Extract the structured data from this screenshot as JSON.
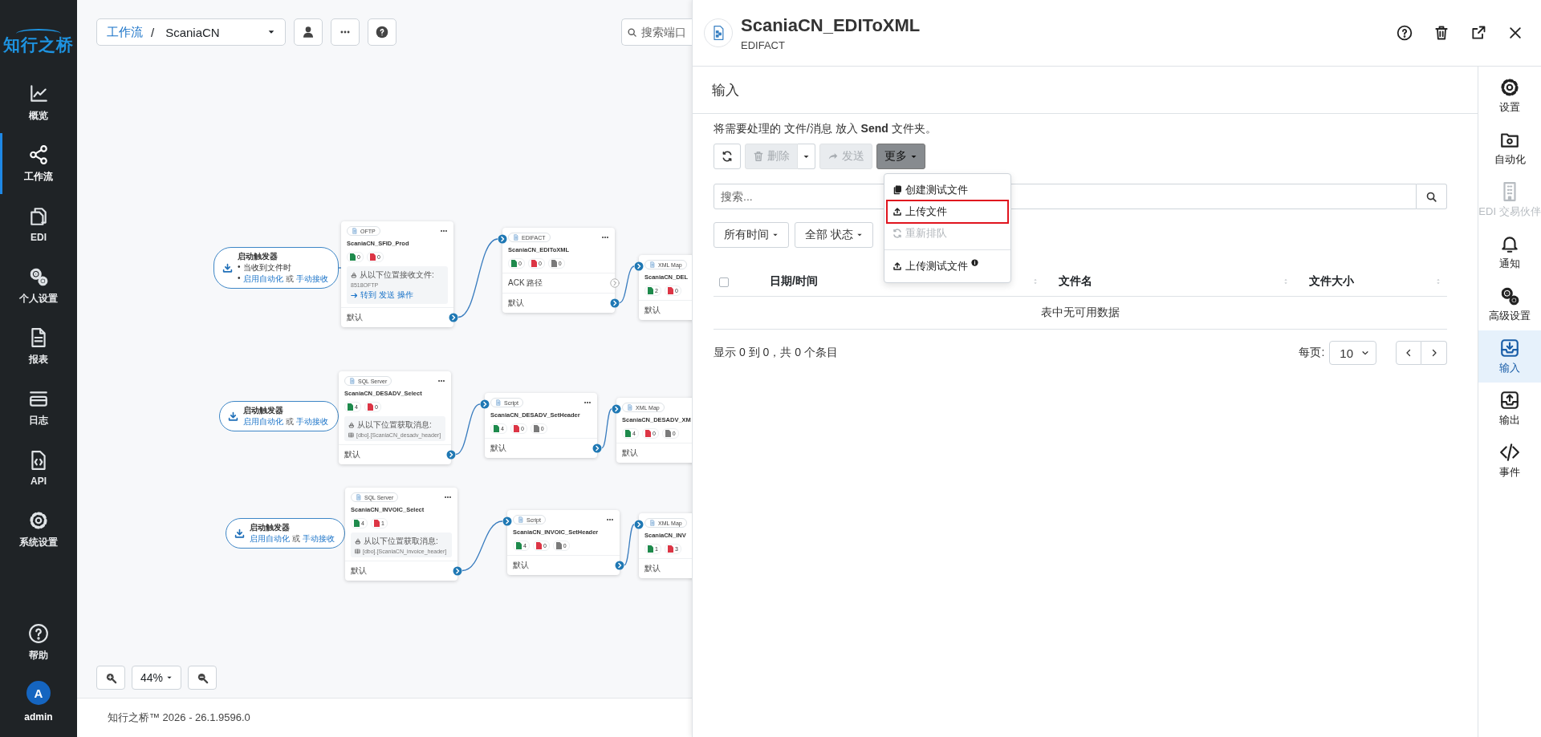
{
  "sidebar": {
    "logo": "知行之桥",
    "items": [
      {
        "label": "概览",
        "selected": false
      },
      {
        "label": "工作流",
        "selected": true
      },
      {
        "label": "EDI",
        "selected": false
      },
      {
        "label": "个人设置",
        "selected": false
      },
      {
        "label": "报表",
        "selected": false
      },
      {
        "label": "日志",
        "selected": false
      },
      {
        "label": "API",
        "selected": false
      },
      {
        "label": "系统设置",
        "selected": false
      }
    ],
    "help": "帮助",
    "user": {
      "initial": "A",
      "name": "admin"
    }
  },
  "toolbar": {
    "breadcrumb": {
      "root": "工作流",
      "separator": "/",
      "current": "ScaniaCN"
    },
    "search": {
      "placeholder": "搜索端口"
    }
  },
  "flows": [
    {
      "trigger": {
        "title": "启动触发器",
        "bullet": "•",
        "lines": [
          "当收到文件时"
        ],
        "links": [
          "启用自动化",
          "手动接收"
        ],
        "conjunction": "或"
      },
      "nodes": [
        {
          "kind": "source",
          "tag": "OFTP",
          "title": "ScaniaCN_SFID_Prod",
          "counts": [
            {
              "color": "#1e8a4c",
              "value": "0"
            },
            {
              "color": "#dc3545",
              "value": "0"
            }
          ],
          "info": {
            "heading": "从以下位置接收文件:",
            "lines": [
              "8518OFTP"
            ],
            "link": "转到 发送 操作"
          },
          "outputs": [
            {
              "label": "默认",
              "connected": true
            }
          ]
        },
        {
          "kind": "process",
          "tag": "EDIFACT",
          "title": "ScaniaCN_EDIToXML",
          "counts": [
            {
              "color": "#1e8a4c",
              "value": "0"
            },
            {
              "color": "#dc3545",
              "value": "0"
            },
            {
              "color": "#7a7a7a",
              "value": "0"
            }
          ],
          "outputs": [
            {
              "label": "ACK 路径",
              "connected": false
            },
            {
              "label": "默认",
              "connected": true
            }
          ]
        },
        {
          "kind": "process",
          "tag": "XML Map",
          "title": "ScaniaCN_DEL",
          "counts": [
            {
              "color": "#1e8a4c",
              "value": "2"
            },
            {
              "color": "#dc3545",
              "value": "0"
            }
          ],
          "outputs": [
            {
              "label": "默认"
            }
          ]
        }
      ]
    },
    {
      "trigger": {
        "title": "启动触发器",
        "links": [
          "启用自动化",
          "手动接收"
        ],
        "conjunction": "或"
      },
      "nodes": [
        {
          "kind": "source",
          "tag": "SQL Server",
          "title": "ScaniaCN_DESADV_Select",
          "counts": [
            {
              "color": "#1e8a4c",
              "value": "4"
            },
            {
              "color": "#dc3545",
              "value": "0"
            }
          ],
          "info": {
            "heading": "从以下位置获取消息:",
            "lines": [
              "[dbo].[ScaniaCN_desadv_header]"
            ]
          },
          "outputs": [
            {
              "label": "默认",
              "connected": true
            }
          ]
        },
        {
          "kind": "process",
          "tag": "Script",
          "title": "ScaniaCN_DESADV_SetHeader",
          "counts": [
            {
              "color": "#1e8a4c",
              "value": "4"
            },
            {
              "color": "#dc3545",
              "value": "0"
            },
            {
              "color": "#7a7a7a",
              "value": "0"
            }
          ],
          "outputs": [
            {
              "label": "默认",
              "connected": true
            }
          ]
        },
        {
          "kind": "process",
          "tag": "XML Map",
          "title": "ScaniaCN_DESADV_XM",
          "counts": [
            {
              "color": "#1e8a4c",
              "value": "4"
            },
            {
              "color": "#dc3545",
              "value": "0"
            },
            {
              "color": "#7a7a7a",
              "value": "0"
            }
          ],
          "outputs": [
            {
              "label": "默认"
            }
          ]
        }
      ]
    },
    {
      "trigger": {
        "title": "启动触发器",
        "links": [
          "启用自动化",
          "手动接收"
        ],
        "conjunction": "或"
      },
      "nodes": [
        {
          "kind": "source",
          "tag": "SQL Server",
          "title": "ScaniaCN_INVOIC_Select",
          "counts": [
            {
              "color": "#1e8a4c",
              "value": "4"
            },
            {
              "color": "#dc3545",
              "value": "1"
            }
          ],
          "info": {
            "heading": "从以下位置获取消息:",
            "lines": [
              "[dbo].[ScaniaCN_invoice_header]"
            ]
          },
          "outputs": [
            {
              "label": "默认",
              "connected": true
            }
          ]
        },
        {
          "kind": "process",
          "tag": "Script",
          "title": "ScaniaCN_INVOIC_SetHeader",
          "counts": [
            {
              "color": "#1e8a4c",
              "value": "4"
            },
            {
              "color": "#dc3545",
              "value": "0"
            },
            {
              "color": "#7a7a7a",
              "value": "0"
            }
          ],
          "outputs": [
            {
              "label": "默认",
              "connected": true
            }
          ]
        },
        {
          "kind": "process",
          "tag": "XML Map",
          "title": "ScaniaCN_INV",
          "counts": [
            {
              "color": "#1e8a4c",
              "value": "1"
            },
            {
              "color": "#dc3545",
              "value": "3"
            }
          ],
          "outputs": [
            {
              "label": "默认"
            }
          ]
        }
      ]
    }
  ],
  "zoom": {
    "text": "44%"
  },
  "footer": "知行之桥™ 2026 - 26.1.9596.0",
  "panel": {
    "title": "ScaniaCN_EDIToXML",
    "subtitle": "EDIFACT",
    "section": "输入",
    "instruction": "将需要处理的 文件/消息 放入 **Send** 文件夹。",
    "buttons": [
      {
        "kind": "icon",
        "disabled": false
      },
      {
        "kind": "split",
        "label": "删除",
        "disabled": true
      },
      {
        "kind": "button",
        "label": "发送",
        "disabled": true
      },
      {
        "kind": "dropdown",
        "label": "更多",
        "expanded": true
      }
    ],
    "menu": [
      {
        "label": "创建测试文件",
        "disabled": false,
        "highlighted": false,
        "separated": false,
        "info": false
      },
      {
        "label": "上传文件",
        "disabled": false,
        "highlighted": true,
        "separated": false,
        "info": false
      },
      {
        "label": "重新排队",
        "disabled": true,
        "highlighted": false,
        "separated": false,
        "info": false
      },
      {
        "label": "上传测试文件",
        "disabled": false,
        "highlighted": false,
        "separated": true,
        "info": true
      }
    ],
    "search": {
      "placeholder": "搜索..."
    },
    "filters": [
      "所有时间",
      "全部 状态"
    ],
    "table": {
      "select_all": {
        "checked": false
      },
      "columns": [
        {
          "label": "日期/时间",
          "sortable": true
        },
        {
          "label": "文件名",
          "sortable": true
        },
        {
          "label": "文件大小",
          "sortable": true
        }
      ],
      "empty": "表中无可用数据"
    },
    "pager": {
      "summary": "显示 0 到 0，共 0 个条目",
      "per_page_label": "每页:",
      "per_page": "10"
    },
    "nav": [
      {
        "label": "设置",
        "selected": false,
        "disabled": false
      },
      {
        "label": "自动化",
        "selected": false,
        "disabled": false
      },
      {
        "label": "EDI 交易伙伴",
        "selected": false,
        "disabled": true
      },
      {
        "label": "通知",
        "selected": false,
        "disabled": false
      },
      {
        "label": "高级设置",
        "selected": false,
        "disabled": false
      },
      {
        "label": "输入",
        "selected": true,
        "disabled": false
      },
      {
        "label": "输出",
        "selected": false,
        "disabled": false
      },
      {
        "label": "事件",
        "selected": false,
        "disabled": false
      }
    ]
  }
}
